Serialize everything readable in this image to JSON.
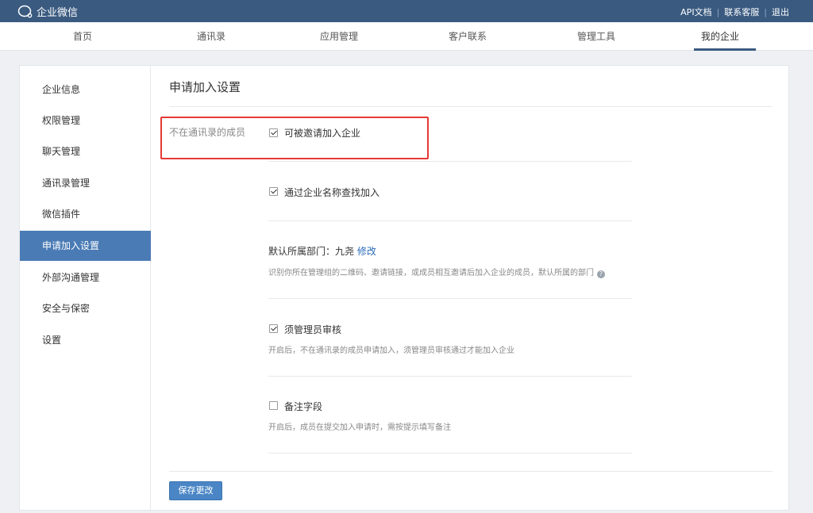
{
  "app": {
    "logo_text": "企业微信"
  },
  "top_links": {
    "api_docs": "API文档",
    "sep1": "|",
    "support": "联系客服",
    "sep2": "|",
    "logout": "退出"
  },
  "nav": {
    "items": [
      {
        "label": "首页"
      },
      {
        "label": "通讯录"
      },
      {
        "label": "应用管理"
      },
      {
        "label": "客户联系"
      },
      {
        "label": "管理工具"
      },
      {
        "label": "我的企业"
      }
    ],
    "active_index": 5
  },
  "sidebar": {
    "items": [
      {
        "label": "企业信息"
      },
      {
        "label": "权限管理"
      },
      {
        "label": "聊天管理"
      },
      {
        "label": "通讯录管理"
      },
      {
        "label": "微信插件"
      },
      {
        "label": "申请加入设置"
      },
      {
        "label": "外部沟通管理"
      },
      {
        "label": "安全与保密"
      },
      {
        "label": "设置"
      }
    ],
    "active_index": 5
  },
  "content": {
    "title": "申请加入设置",
    "row_label": "不在通讯录的成员",
    "options": [
      {
        "label": "可被邀请加入企业",
        "checked": true
      },
      {
        "label": "通过企业名称查找加入",
        "checked": true
      },
      {
        "label": "须管理员审核",
        "checked": true,
        "desc": "开启后，不在通讯录的成员申请加入，须管理员审核通过才能加入企业"
      },
      {
        "label": "备注字段",
        "checked": false,
        "desc": "开启后，成员在提交加入申请时，需按提示填写备注"
      }
    ],
    "default_dept": {
      "label": "默认所属部门：九尧",
      "edit": "修改",
      "desc": "识别你所在管理组的二维码、邀请链接，或成员相互邀请后加入企业的成员，默认所属的部门",
      "help": "?"
    },
    "save_label": "保存更改"
  },
  "colors": {
    "topbar": "#3a5a80",
    "active_sidebar": "#4a7bb5",
    "highlight_box": "#e53935",
    "link": "#2c6cb8",
    "button": "#4a86c5"
  }
}
